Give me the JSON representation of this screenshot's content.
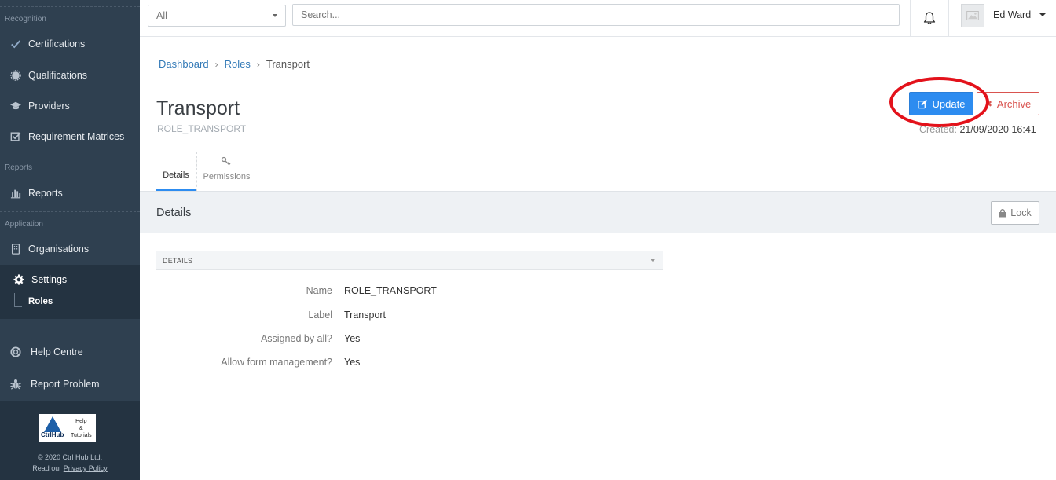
{
  "sidebar": {
    "sections": {
      "recognition": "Recognition",
      "reports": "Reports",
      "application": "Application"
    },
    "items": {
      "certifications": "Certifications",
      "qualifications": "Qualifications",
      "providers": "Providers",
      "requirement_matrices": "Requirement Matrices",
      "reports": "Reports",
      "organisations": "Organisations",
      "settings": "Settings",
      "roles": "Roles",
      "help_centre": "Help Centre",
      "report_problem": "Report Problem"
    },
    "footer": {
      "logo_word": "CtrlHub",
      "logo_help_1": "Help",
      "logo_help_2": "&",
      "logo_help_3": "Tutorials",
      "copyright": "© 2020 Ctrl Hub Ltd.",
      "policy_prefix": "Read our",
      "policy_link": "Privacy Policy"
    }
  },
  "topbar": {
    "scope_select": "All",
    "search_placeholder": "Search...",
    "user_name": "Ed Ward"
  },
  "breadcrumb": {
    "dashboard": "Dashboard",
    "roles": "Roles",
    "current": "Transport",
    "sep": "›"
  },
  "page": {
    "title": "Transport",
    "subtitle": "ROLE_TRANSPORT",
    "update_label": "Update",
    "archive_label": "Archive",
    "created_label": "Created:",
    "created_value": "21/09/2020 16:41"
  },
  "tabs": {
    "details": "Details",
    "permissions": "Permissions"
  },
  "details_panel": {
    "heading": "Details",
    "lock_label": "Lock",
    "section_title": "DETAILS",
    "fields": [
      {
        "label": "Name",
        "value": "ROLE_TRANSPORT"
      },
      {
        "label": "Label",
        "value": "Transport"
      },
      {
        "label": "Assigned by all?",
        "value": "Yes"
      },
      {
        "label": "Allow form management?",
        "value": "Yes"
      }
    ]
  },
  "colors": {
    "sidebar_bg": "#2f4050",
    "primary": "#2d8cf0",
    "danger": "#d9534f",
    "highlight_oval": "#e3121b"
  }
}
